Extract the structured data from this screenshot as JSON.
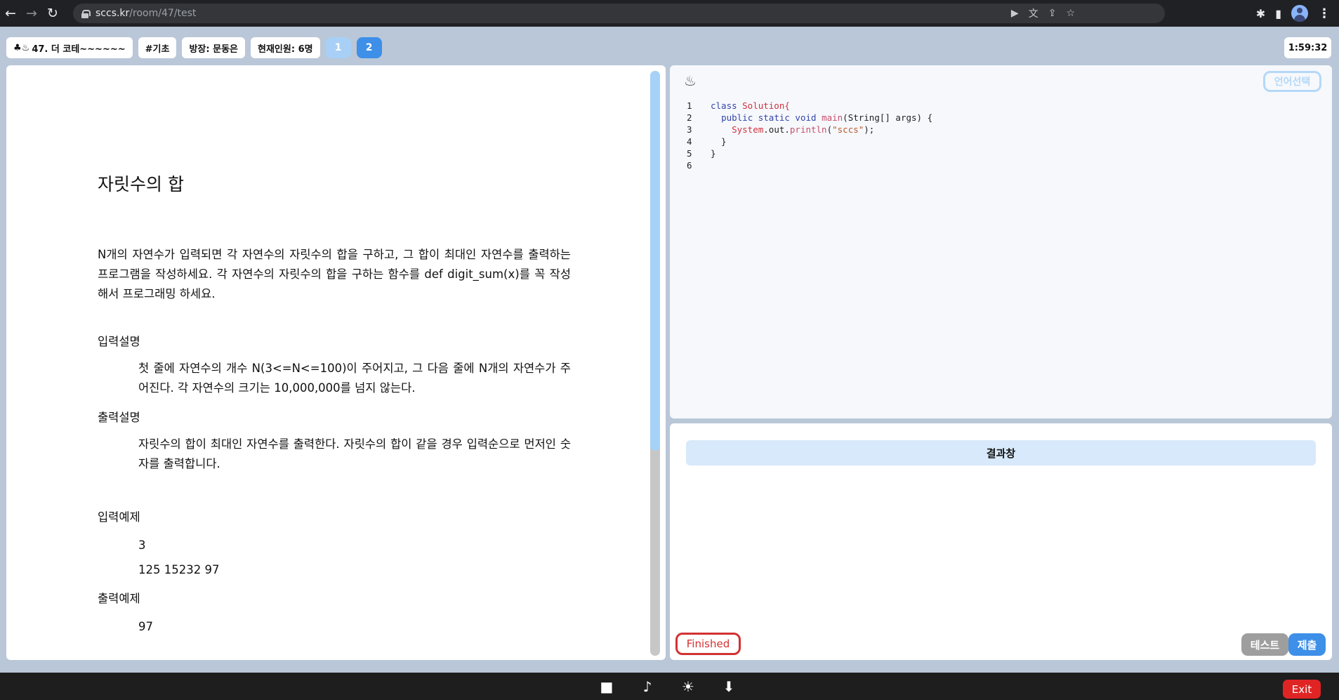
{
  "browser": {
    "url_host": "sccs.kr",
    "url_path": "/room/47/test",
    "icons": {
      "back": "←",
      "forward": "→",
      "reload": "↻",
      "camera": "▶",
      "translate": "文",
      "share": "⇪",
      "star": "☆",
      "extensions": "✱",
      "sidepanel": "▮",
      "menu": "⋮"
    }
  },
  "header": {
    "room_title": "47. 더 코테~~~~~~",
    "room_icon": "♣♨",
    "tag": "#기초",
    "host": "방장: 문동은",
    "members": "현재인원: 6명",
    "pages": [
      "1",
      "2"
    ],
    "timer": "1:59:32"
  },
  "problem": {
    "title": "자릿수의 합",
    "description": "N개의 자연수가 입력되면 각 자연수의 자릿수의 합을 구하고, 그 합이 최대인 자연수를 출력하는 프로그램을 작성하세요. 각 자연수의 자릿수의 합을 구하는 함수를 def digit_sum(x)를 꼭 작성해서 프로그래밍 하세요.",
    "input_heading": "입력설명",
    "input_text": "첫 줄에 자연수의 개수 N(3<=N<=100)이 주어지고, 그 다음 줄에 N개의 자연수가 주어진다. 각 자연수의 크기는 10,000,000를 넘지 않는다.",
    "output_heading": "출력설명",
    "output_text": "자릿수의 합이 최대인 자연수를 출력한다. 자릿수의 합이 같을 경우 입력순으로 먼저인 숫자를 출력합니다.",
    "example_input_heading": "입력예제",
    "example_input_lines": [
      "3",
      "125 15232 97"
    ],
    "example_output_heading": "출력예제",
    "example_output_lines": [
      "97"
    ]
  },
  "editor": {
    "lang_icon": "♨",
    "lang_button": "언어선택",
    "line_numbers": [
      "1",
      "2",
      "3",
      "4",
      "5",
      "6"
    ],
    "code": {
      "l1_kw": "class ",
      "l1_name": "Solution{",
      "l2_indent": "  ",
      "l2_kw": "public static void ",
      "l2_fn": "main",
      "l2_rest": "(String[] args) {",
      "l3_indent": "    ",
      "l3_sys": "System",
      "l3_dot1": ".out.",
      "l3_fn": "println",
      "l3_open": "(",
      "l3_str": "\"sccs\"",
      "l3_close": ");",
      "l4": "  }",
      "l5": "}",
      "l6": ""
    }
  },
  "result": {
    "heading": "결과창",
    "status": "Finished",
    "test_button": "테스트",
    "submit_button": "제출"
  },
  "footer": {
    "camera_icon": "■",
    "mic_icon": "♪",
    "brightness_icon": "☀",
    "share_icon": "⬇",
    "exit": "Exit"
  },
  "colors": {
    "page_bg": "#b9c7d8",
    "accent": "#3d8fe8",
    "finished_red": "#d23232",
    "exit_red": "#e02424"
  }
}
